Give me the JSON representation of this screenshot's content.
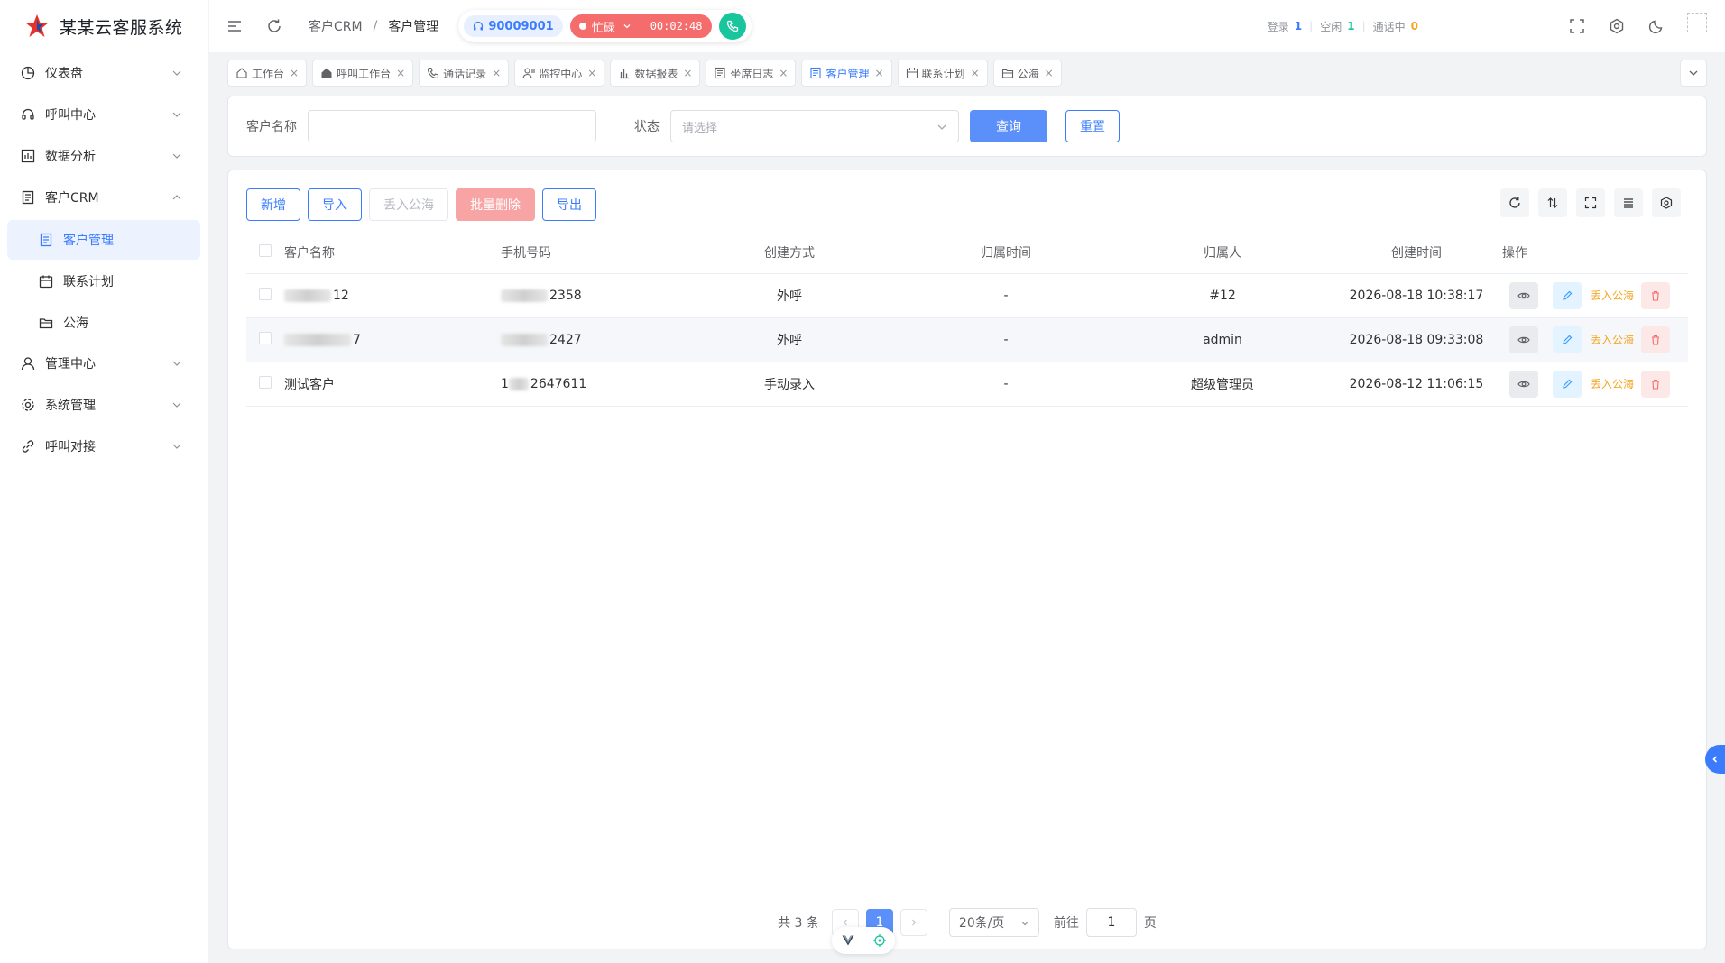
{
  "app": {
    "title": "某某云客服系统"
  },
  "sidebar": {
    "items": [
      {
        "label": "仪表盘"
      },
      {
        "label": "呼叫中心"
      },
      {
        "label": "数据分析"
      },
      {
        "label": "客户CRM",
        "children": [
          {
            "label": "客户管理"
          },
          {
            "label": "联系计划"
          },
          {
            "label": "公海"
          }
        ]
      },
      {
        "label": "管理中心"
      },
      {
        "label": "系统管理"
      },
      {
        "label": "呼叫对接"
      }
    ]
  },
  "header": {
    "breadcrumb": [
      "客户CRM",
      "客户管理"
    ],
    "breadcrumb_sep": "/",
    "agent_id": "90009001",
    "status": "忙碌",
    "timer": "00:02:48",
    "stats": {
      "login_label": "登录",
      "login_value": "1",
      "idle_label": "空闲",
      "idle_value": "1",
      "talking_label": "通话中",
      "talking_value": "0",
      "sep": "|"
    }
  },
  "tabs": [
    {
      "label": "工作台",
      "icon": "home-icon"
    },
    {
      "label": "呼叫工作台",
      "icon": "house-icon"
    },
    {
      "label": "通话记录",
      "icon": "phone-icon"
    },
    {
      "label": "监控中心",
      "icon": "monitor-icon"
    },
    {
      "label": "数据报表",
      "icon": "bar-chart-icon"
    },
    {
      "label": "坐席日志",
      "icon": "log-icon"
    },
    {
      "label": "客户管理",
      "icon": "customer-icon",
      "active": true
    },
    {
      "label": "联系计划",
      "icon": "calendar-icon"
    },
    {
      "label": "公海",
      "icon": "sea-icon"
    }
  ],
  "tab_close": "×",
  "search": {
    "name_label": "客户名称",
    "name_value": "",
    "status_label": "状态",
    "status_placeholder": "请选择",
    "query_label": "查询",
    "reset_label": "重置"
  },
  "toolbar": {
    "add": "新增",
    "import": "导入",
    "to_sea": "丢入公海",
    "batch_delete": "批量删除",
    "export": "导出"
  },
  "table": {
    "headers": [
      "客户名称",
      "手机号码",
      "创建方式",
      "归属时间",
      "归属人",
      "创建时间",
      "操作"
    ],
    "rows": [
      {
        "name_visible": "12",
        "phone_visible": "2358",
        "method": "外呼",
        "assign_time": "-",
        "owner": "#12",
        "created": "2026-08-18 10:38:17"
      },
      {
        "name_visible": "7",
        "phone_visible": "2427",
        "method": "外呼",
        "assign_time": "-",
        "owner": "admin",
        "created": "2026-08-18 09:33:08"
      },
      {
        "name_visible": "测试客户",
        "phone_visible": "2647611",
        "phone_prefix": "1",
        "method": "手动录入",
        "assign_time": "-",
        "owner": "超级管理员",
        "created": "2026-08-12 11:06:15"
      }
    ],
    "op_to_sea": "丢入公海"
  },
  "pagination": {
    "total": "共 3 条",
    "current": "1",
    "page_size": "20条/页",
    "goto_label": "前往",
    "goto_value": "1",
    "page_unit": "页"
  },
  "colors": {
    "primary": "#3b7cff",
    "danger": "#f56c6c",
    "success": "#19c59d",
    "warning": "#f5a623"
  }
}
